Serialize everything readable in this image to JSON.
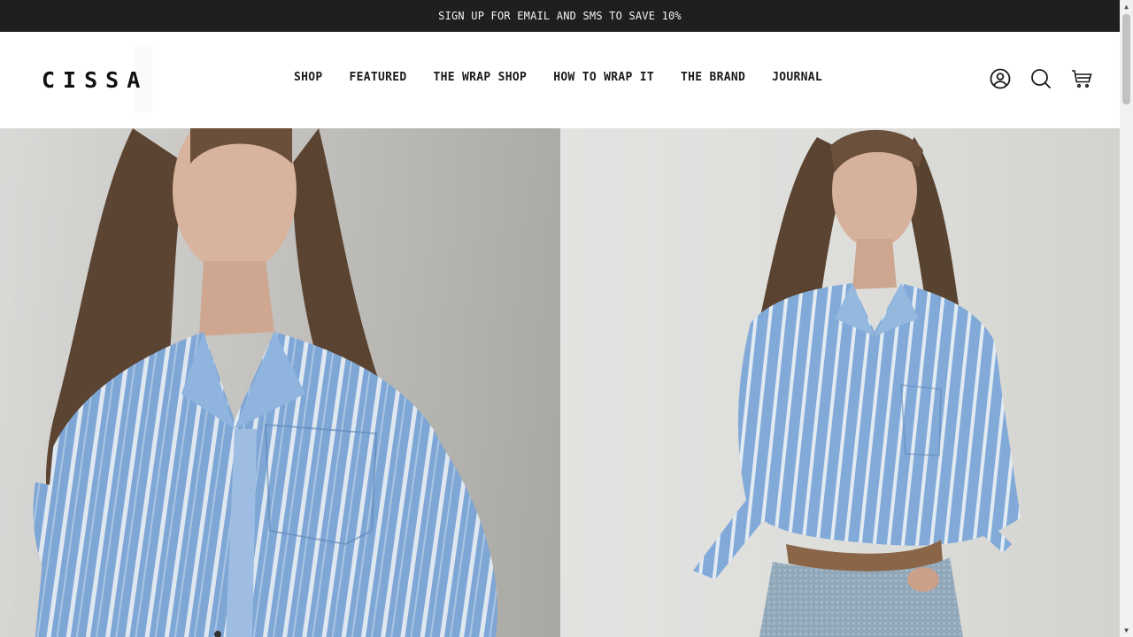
{
  "announcement": {
    "text": "SIGN UP FOR EMAIL AND SMS TO SAVE 10%"
  },
  "header": {
    "logo": "CISSA",
    "nav": [
      {
        "label": "SHOP"
      },
      {
        "label": "FEATURED"
      },
      {
        "label": "THE WRAP SHOP"
      },
      {
        "label": "HOW TO WRAP IT"
      },
      {
        "label": "THE BRAND"
      },
      {
        "label": "JOURNAL"
      }
    ],
    "icons": [
      "account-icon",
      "search-icon",
      "cart-icon"
    ]
  },
  "hero": {
    "images": [
      {
        "description": "model-in-blue-striped-shirt-closeup"
      },
      {
        "description": "model-in-blue-striped-shirt-and-jeans"
      }
    ]
  },
  "colors": {
    "announcement_bg": "#1f1f1f",
    "shirt_blue": "#7fa8d8",
    "shirt_stripe": "#dfe8f0"
  }
}
